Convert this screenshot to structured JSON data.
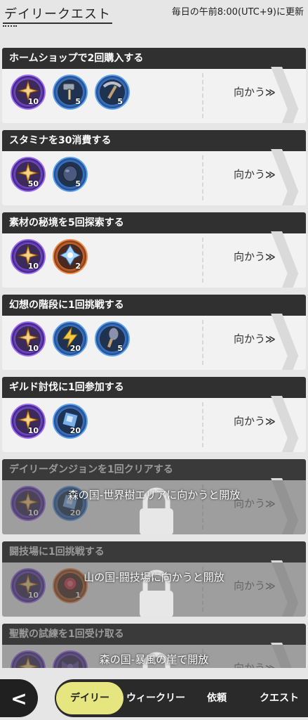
{
  "header": {
    "title": "デイリークエスト",
    "refresh": "毎日の午前8:00(UTC+9)に更新"
  },
  "go_label": "向かう",
  "go_arrow": "≫",
  "quests": [
    {
      "title": "ホームショップで2回購入する",
      "rewards": [
        {
          "icon": "star-crystal-icon",
          "rarity": "purple",
          "count": "10"
        },
        {
          "icon": "hammer-icon",
          "rarity": "blue",
          "count": "5"
        },
        {
          "icon": "pickaxe-icon",
          "rarity": "blue",
          "count": "5"
        }
      ]
    },
    {
      "title": "スタミナを30消費する",
      "rewards": [
        {
          "icon": "star-crystal-icon",
          "rarity": "purple",
          "count": "50"
        },
        {
          "icon": "glove-icon",
          "rarity": "blue",
          "count": "5"
        }
      ]
    },
    {
      "title": "素材の秘境を5回探索する",
      "rewards": [
        {
          "icon": "star-crystal-icon",
          "rarity": "purple",
          "count": "10"
        },
        {
          "icon": "ice-crystal-icon",
          "rarity": "orange",
          "count": "2"
        }
      ]
    },
    {
      "title": "幻想の階段に1回挑戦する",
      "rewards": [
        {
          "icon": "star-crystal-icon",
          "rarity": "purple",
          "count": "10"
        },
        {
          "icon": "lightning-icon",
          "rarity": "blue",
          "count": "20"
        },
        {
          "icon": "shovel-icon",
          "rarity": "blue",
          "count": "5"
        }
      ]
    },
    {
      "title": "ギルド討伐に1回参加する",
      "rewards": [
        {
          "icon": "star-crystal-icon",
          "rarity": "purple",
          "count": "10"
        },
        {
          "icon": "blue-gem-icon",
          "rarity": "blue",
          "count": "20"
        }
      ]
    },
    {
      "title": "デイリーダンジョンを1回クリアする",
      "locked": true,
      "lock_text": "森の国-世界樹エリアに向かうと開放",
      "rewards": [
        {
          "icon": "star-crystal-icon",
          "rarity": "purple",
          "count": "10"
        },
        {
          "icon": "blue-gem-icon",
          "rarity": "blue",
          "count": "20"
        }
      ]
    },
    {
      "title": "闘技場に1回挑戦する",
      "locked": true,
      "lock_text": "山の国-闘技場に向かうと開放",
      "rewards": [
        {
          "icon": "star-crystal-icon",
          "rarity": "purple",
          "count": "10"
        },
        {
          "icon": "rose-icon",
          "rarity": "orange",
          "count": "1"
        }
      ]
    },
    {
      "title": "聖獣の試練を1回受け取る",
      "locked": true,
      "lock_text": "森の国-暴風の崖で開放",
      "rewards": [
        {
          "icon": "star-crystal-icon",
          "rarity": "purple",
          "count": ""
        },
        {
          "icon": "ribbon-icon",
          "rarity": "purple",
          "count": ""
        }
      ]
    }
  ],
  "nav": {
    "back_icon": "chevron-left-icon",
    "back_glyph": "<",
    "tabs": [
      {
        "label": "デイリー",
        "active": true
      },
      {
        "label": "ウィークリー",
        "active": false
      },
      {
        "label": "依頼",
        "active": false
      },
      {
        "label": "クエスト",
        "active": false
      }
    ]
  }
}
